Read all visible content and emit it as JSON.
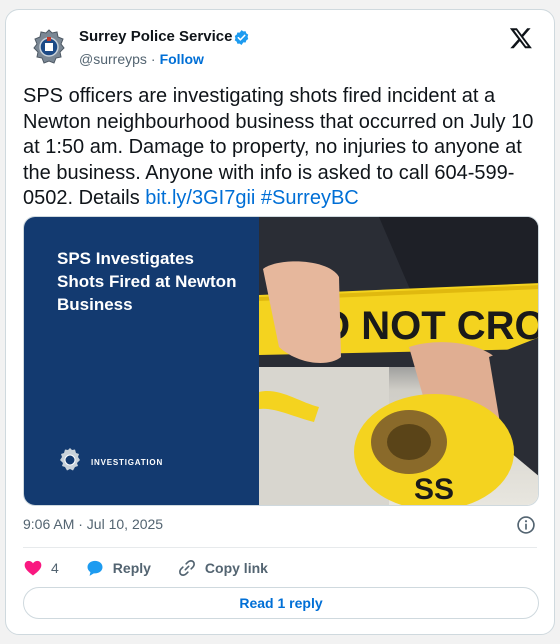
{
  "author": {
    "name": "Surrey Police Service",
    "handle": "@surreyps",
    "separator": "·",
    "follow_label": "Follow",
    "verified_icon": "verified-badge-icon"
  },
  "tweet": {
    "text_main": "SPS officers are investigating shots fired incident at a Newton neighbourhood business that occurred on July 10 at 1:50 am. Damage to property, no injuries to anyone at the business. Anyone with info is asked to call 604-599-0502. Details ",
    "link": "bit.ly/3GI7gii",
    "hashtag": "#SurreyBC"
  },
  "media": {
    "title": "SPS Investigates Shots Fired at Newton Business",
    "label": "INVESTIGATION",
    "tape_text": "O NOT CROSS",
    "tape_text_lower": "SS"
  },
  "meta": {
    "timestamp": "9:06 AM · Jul 10, 2025"
  },
  "actions": {
    "like_count": "4",
    "reply_label": "Reply",
    "copy_link_label": "Copy link",
    "read_replies_label": "Read 1 reply"
  },
  "colors": {
    "link": "#006fd6",
    "brand_blue": "#133a70",
    "like": "#f91880",
    "verified": "#1d9bf0"
  }
}
